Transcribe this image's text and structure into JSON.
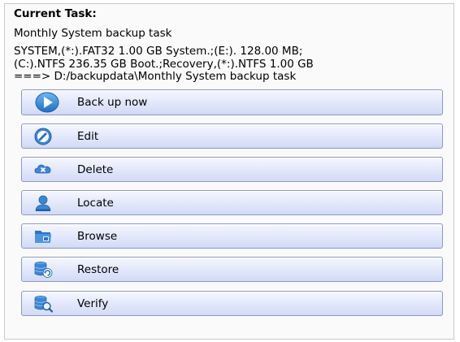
{
  "header": {
    "title": "Current Task:"
  },
  "task": {
    "name": "Monthly System backup task",
    "details": [
      "SYSTEM,(*:).FAT32 1.00 GB System.;(E:). 128.00 MB;",
      "(C:).NTFS 236.35 GB Boot.;Recovery,(*:).NTFS 1.00 GB",
      "===> D:/backupdata\\Monthly System backup task"
    ]
  },
  "actions": [
    {
      "label": "Back up now",
      "icon": "play-icon"
    },
    {
      "label": "Edit",
      "icon": "edit-icon"
    },
    {
      "label": "Delete",
      "icon": "delete-icon"
    },
    {
      "label": "Locate",
      "icon": "locate-icon"
    },
    {
      "label": "Browse",
      "icon": "folder-icon"
    },
    {
      "label": "Restore",
      "icon": "restore-icon"
    },
    {
      "label": "Verify",
      "icon": "verify-icon"
    }
  ],
  "colors": {
    "button_border": "#8d98c8",
    "button_gradient_top": "#f6f8ff",
    "button_gradient_bottom": "#d2daf5",
    "icon_blue": "#3d86d6"
  }
}
